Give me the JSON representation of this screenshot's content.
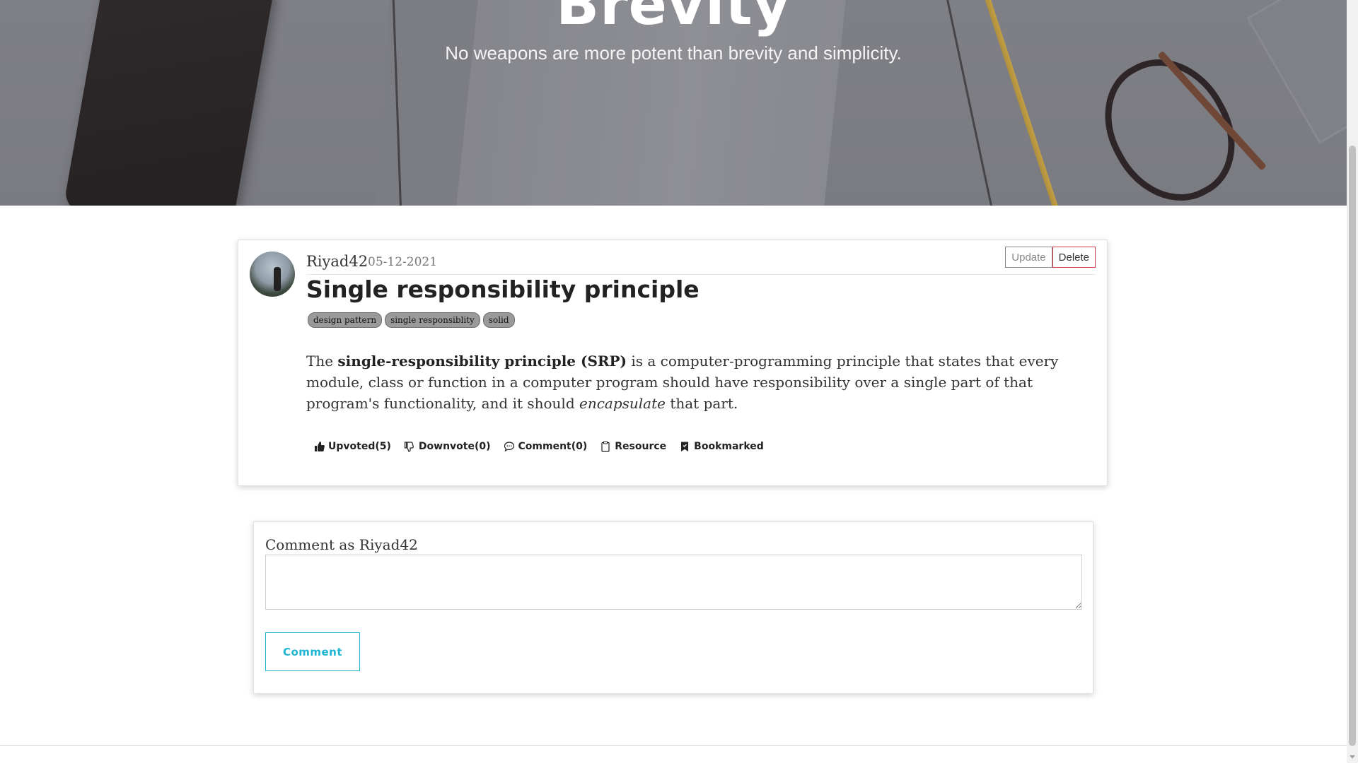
{
  "hero": {
    "title": "Brevity",
    "subtitle": "No weapons are more potent than brevity and simplicity."
  },
  "post": {
    "author": "Riyad42",
    "date": "05-12-2021",
    "title": "Single responsibility principle",
    "update_label": "Update",
    "delete_label": "Delete",
    "tags": [
      "design pattern",
      "single responsiblity",
      "solid"
    ],
    "body": {
      "p1": "The ",
      "bold": "single-responsibility principle (SRP)",
      "p2": " is a computer-programming principle that states that every module, class or function in a computer program should have responsibility over a single part of that program's functionality, and it should ",
      "italic": "encapsulate",
      "p3": " that part."
    },
    "actions": {
      "upvote": "Upvoted(5)",
      "downvote": "Downvote(0)",
      "comment": "Comment(0)",
      "resource": "Resource",
      "bookmark": "Bookmarked"
    }
  },
  "comment_form": {
    "label": "Comment as Riyad42",
    "textarea_value": "",
    "button_label": "Comment"
  },
  "colors": {
    "accent": "#1fb6d3",
    "delete": "#d8404c",
    "tag_bg": "#9a9a9a"
  }
}
